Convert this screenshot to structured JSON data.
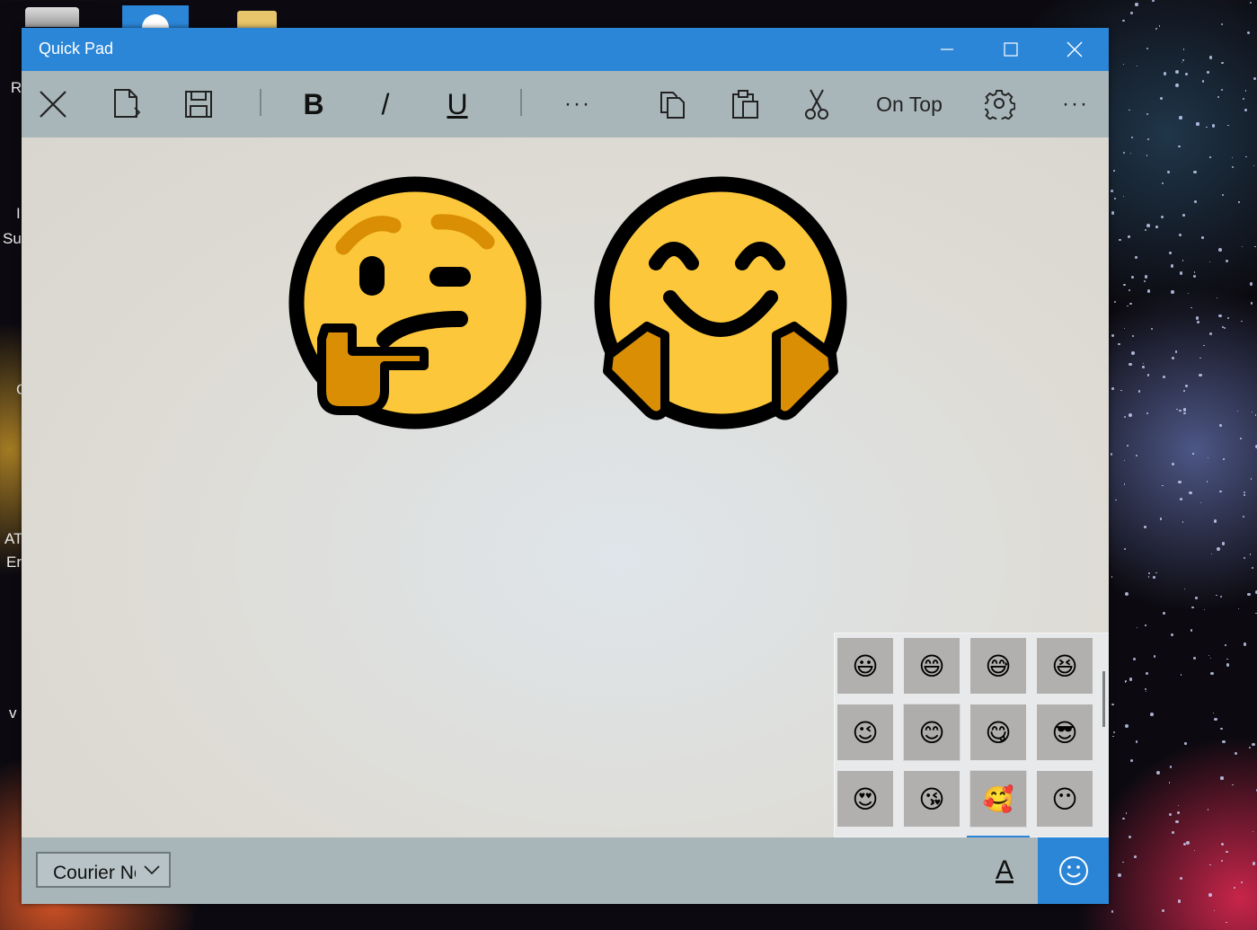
{
  "desktop": {
    "left_labels": [
      "R",
      "I",
      "Su",
      "C",
      "AT",
      "Er",
      "v"
    ]
  },
  "window": {
    "title": "Quick Pad",
    "controls": {
      "minimize": "minimize",
      "maximize": "maximize",
      "close": "close"
    }
  },
  "toolbar": {
    "items": [
      {
        "name": "close-file",
        "icon": "close-icon"
      },
      {
        "name": "new-file",
        "icon": "new-document-icon"
      },
      {
        "name": "save",
        "icon": "save-icon"
      },
      {
        "name": "bold",
        "label": "B"
      },
      {
        "name": "italic",
        "label": "/"
      },
      {
        "name": "underline",
        "label": "U"
      },
      {
        "name": "more-format",
        "label": "···"
      },
      {
        "name": "copy",
        "icon": "copy-icon"
      },
      {
        "name": "paste",
        "icon": "paste-icon"
      },
      {
        "name": "cut",
        "icon": "scissors-icon"
      },
      {
        "name": "on-top",
        "label": "On Top"
      },
      {
        "name": "settings",
        "icon": "gear-icon"
      },
      {
        "name": "more",
        "label": "···"
      }
    ]
  },
  "editor": {
    "emojis": [
      "thinking-face",
      "hugging-face"
    ]
  },
  "emoji_picker": {
    "emojis": [
      "😃",
      "😄",
      "😅",
      "😆",
      "😉",
      "😊",
      "😋",
      "😎",
      "😍",
      "😘",
      "🥰",
      "😶"
    ],
    "selected_index": 5
  },
  "bottombar": {
    "font_name": "Courier New",
    "color_label": "A",
    "emoji_icon": "smiley-icon"
  },
  "colors": {
    "accent": "#2b86d8",
    "toolbar_bg": "#a9b6b9",
    "emoji_yellow": "#fcc73a",
    "emoji_hand": "#d98e04"
  }
}
